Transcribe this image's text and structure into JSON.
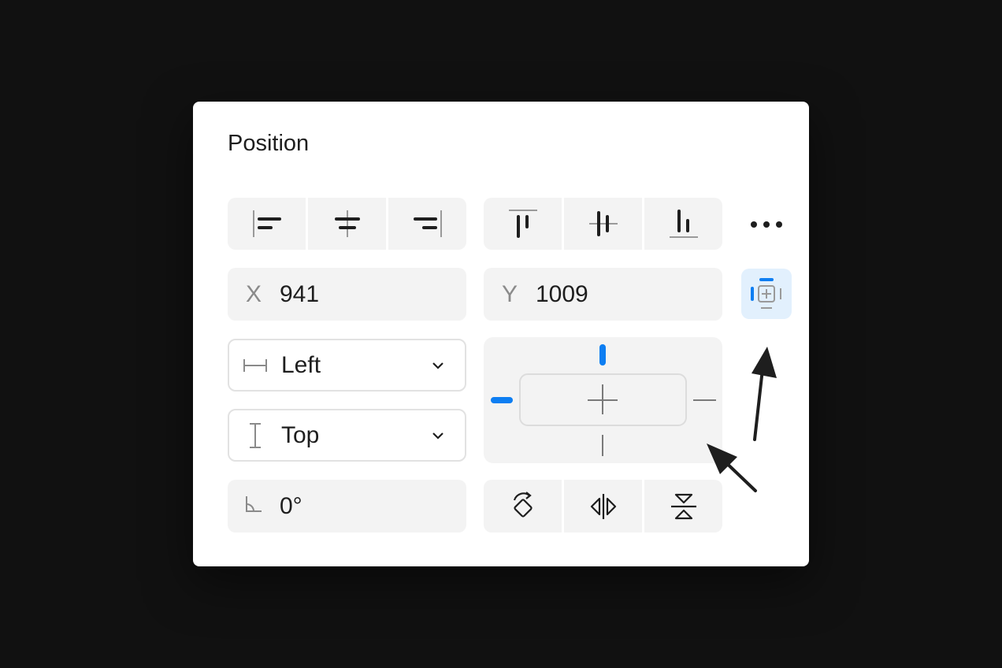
{
  "panel": {
    "title": "Position"
  },
  "align": {
    "horizontal": [
      {
        "icon": "align-left-icon"
      },
      {
        "icon": "align-horizontal-center-icon"
      },
      {
        "icon": "align-right-icon"
      }
    ],
    "vertical": [
      {
        "icon": "align-top-icon"
      },
      {
        "icon": "align-vertical-center-icon"
      },
      {
        "icon": "align-bottom-icon"
      }
    ],
    "more_icon": "more-horizontal-icon"
  },
  "position": {
    "x_label": "X",
    "x_value": "941",
    "y_label": "Y",
    "y_value": "1009",
    "constraints_toggle_icon": "constraints-icon"
  },
  "constraints": {
    "horizontal": "Left",
    "vertical": "Top",
    "active_color": "#0d7ef2",
    "left_active": true,
    "top_active": true,
    "right_active": false,
    "bottom_active": false
  },
  "rotation": {
    "value": "0°",
    "icon": "angle-icon"
  },
  "transform": [
    {
      "icon": "rotate-90-icon"
    },
    {
      "icon": "flip-horizontal-icon"
    },
    {
      "icon": "flip-vertical-icon"
    }
  ]
}
